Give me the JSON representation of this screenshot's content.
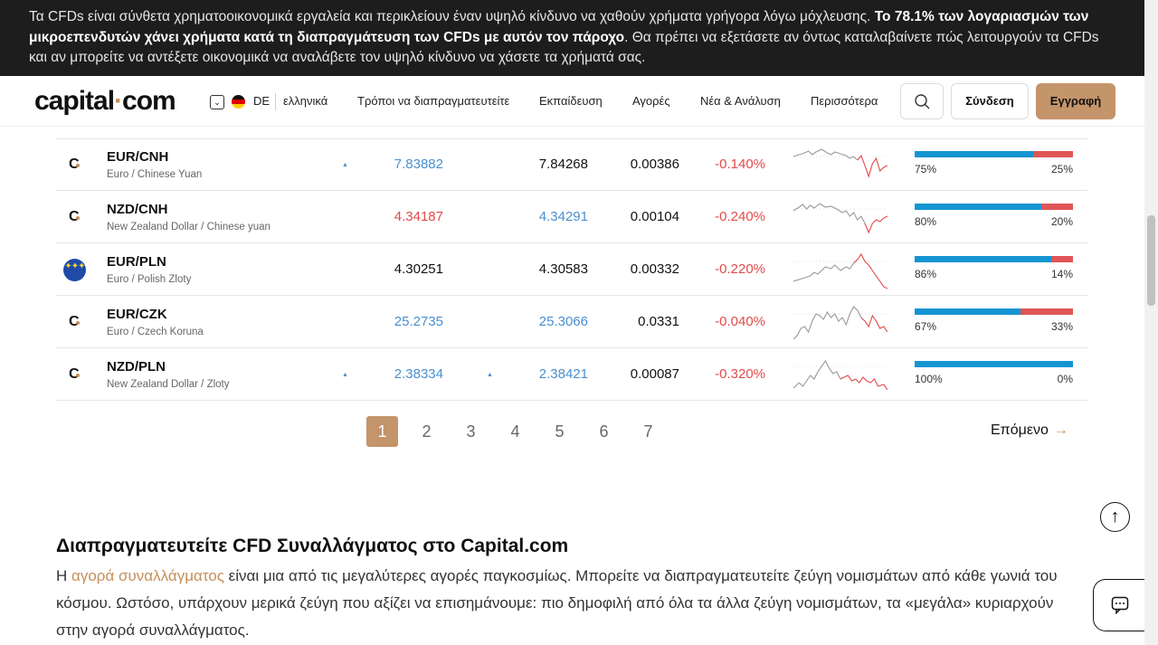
{
  "risk_banner": {
    "text_a": "Τα CFDs είναι σύνθετα χρηματοοικονομικά εργαλεία και περικλείουν έναν υψηλό κίνδυνο να χαθούν χρήματα γρήγορα λόγω μόχλευσης. ",
    "text_bold": "Το 78.1% των λογαριασμών των μικροεπενδυτών χάνει χρήματα κατά τη διαπραγμάτευση των CFDs με αυτόν τον πάροχο",
    "text_b": ". Θα πρέπει να εξετάσετε αν όντως καταλαβαίνετε πώς λειτουργούν τα CFDs και αν μπορείτε να αντέξετε οικονομικά να αναλάβετε τον υψηλό κίνδυνο να χάσετε τα χρήματά σας."
  },
  "header": {
    "logo_a": "capital",
    "logo_dot": "·",
    "logo_b": "com",
    "lang_code": "DE",
    "lang_name": "ελληνικά",
    "nav": [
      "Τρόποι να διαπραγματευτείτε",
      "Εκπαίδευση",
      "Αγορές",
      "Νέα & Ανάλυση",
      "Περισσότερα"
    ],
    "login": "Σύνδεση",
    "signup": "Εγγραφή"
  },
  "colors": {
    "accent": "#c4946b",
    "buy_bar": "#1495d2",
    "sell_bar": "#e05556",
    "up": "#4a8fd0",
    "down": "#e24b4b"
  },
  "rows": [
    {
      "pair": "EUR/CNH",
      "desc": "Euro / Chinese Yuan",
      "icon": "capital-logo-icon",
      "sell": "7.83882",
      "sell_color": "blue",
      "sell_arrow": true,
      "buy": "7.84268",
      "buy_color": "black",
      "buy_arrow": false,
      "spread": "0.00386",
      "change": "-0.140%",
      "buy_pct": 75,
      "sell_pct": 25,
      "buy_lbl": "75%",
      "sell_lbl": "25%"
    },
    {
      "pair": "NZD/CNH",
      "desc": "New Zealand Dollar / Chinese yuan",
      "icon": "capital-logo-icon",
      "sell": "4.34187",
      "sell_color": "red",
      "sell_arrow": false,
      "buy": "4.34291",
      "buy_color": "blue",
      "buy_arrow": false,
      "spread": "0.00104",
      "change": "-0.240%",
      "buy_pct": 80,
      "sell_pct": 20,
      "buy_lbl": "80%",
      "sell_lbl": "20%"
    },
    {
      "pair": "EUR/PLN",
      "desc": "Euro / Polish Zloty",
      "icon": "eu-flag-icon",
      "sell": "4.30251",
      "sell_color": "black",
      "sell_arrow": false,
      "buy": "4.30583",
      "buy_color": "black",
      "buy_arrow": false,
      "spread": "0.00332",
      "change": "-0.220%",
      "buy_pct": 86,
      "sell_pct": 14,
      "buy_lbl": "86%",
      "sell_lbl": "14%"
    },
    {
      "pair": "EUR/CZK",
      "desc": "Euro / Czech Koruna",
      "icon": "capital-logo-icon",
      "sell": "25.2735",
      "sell_color": "blue",
      "sell_arrow": false,
      "buy": "25.3066",
      "buy_color": "blue",
      "buy_arrow": false,
      "spread": "0.0331",
      "change": "-0.040%",
      "buy_pct": 67,
      "sell_pct": 33,
      "buy_lbl": "67%",
      "sell_lbl": "33%"
    },
    {
      "pair": "NZD/PLN",
      "desc": "New Zealand Dollar / Zloty",
      "icon": "capital-logo-icon",
      "sell": "2.38334",
      "sell_color": "blue",
      "sell_arrow": true,
      "buy": "2.38421",
      "buy_color": "blue",
      "buy_arrow": true,
      "spread": "0.00087",
      "change": "-0.320%",
      "buy_pct": 100,
      "sell_pct": 0,
      "buy_lbl": "100%",
      "sell_lbl": "0%"
    }
  ],
  "pagination": {
    "pages": [
      "1",
      "2",
      "3",
      "4",
      "5",
      "6",
      "7"
    ],
    "active": "1",
    "next": "Επόμενο"
  },
  "article": {
    "title": "Διαπραγματευτείτε CFD Συναλλάγματος στο Capital.com",
    "body_a": "Η ",
    "link": "αγορά συναλλάγματος",
    "body_b": " είναι μια από τις μεγαλύτερες αγορές παγκοσμίως. Μπορείτε να διαπραγματευτείτε ζεύγη νομισμάτων από κάθε γωνιά του κόσμου. Ωστόσο, υπάρχουν μερικά ζεύγη που αξίζει να επισημάνουμε: πιο δημοφιλή από όλα τα άλλα ζεύγη νομισμάτων, τα «μεγάλα» κυριαρχούν στην αγορά συναλλάγματος."
  }
}
